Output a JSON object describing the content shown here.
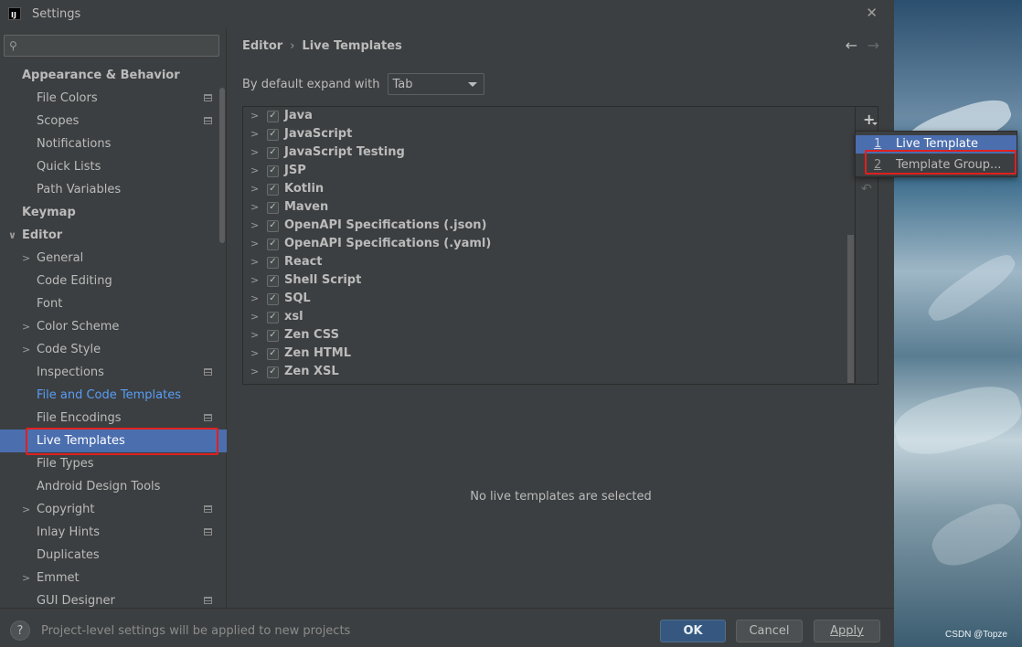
{
  "window": {
    "title": "Settings",
    "logo_text": "IJ"
  },
  "search": {
    "placeholder": "",
    "icon": "search-icon"
  },
  "sidebar": {
    "items": [
      {
        "label": "Appearance & Behavior",
        "level": 0,
        "arrow": "",
        "icon": false
      },
      {
        "label": "File Colors",
        "level": 1,
        "arrow": "",
        "icon": true
      },
      {
        "label": "Scopes",
        "level": 1,
        "arrow": "",
        "icon": true
      },
      {
        "label": "Notifications",
        "level": 1,
        "arrow": "",
        "icon": false
      },
      {
        "label": "Quick Lists",
        "level": 1,
        "arrow": "",
        "icon": false
      },
      {
        "label": "Path Variables",
        "level": 1,
        "arrow": "",
        "icon": false
      },
      {
        "label": "Keymap",
        "level": 0,
        "arrow": "",
        "icon": false
      },
      {
        "label": "Editor",
        "level": 0,
        "arrow": "∨",
        "icon": false
      },
      {
        "label": "General",
        "level": 1,
        "arrow": ">",
        "icon": false
      },
      {
        "label": "Code Editing",
        "level": 1,
        "arrow": "",
        "icon": false
      },
      {
        "label": "Font",
        "level": 1,
        "arrow": "",
        "icon": false
      },
      {
        "label": "Color Scheme",
        "level": 1,
        "arrow": ">",
        "icon": false
      },
      {
        "label": "Code Style",
        "level": 1,
        "arrow": ">",
        "icon": false
      },
      {
        "label": "Inspections",
        "level": 1,
        "arrow": "",
        "icon": true
      },
      {
        "label": "File and Code Templates",
        "level": 1,
        "arrow": "",
        "icon": false,
        "link": true
      },
      {
        "label": "File Encodings",
        "level": 1,
        "arrow": "",
        "icon": true
      },
      {
        "label": "Live Templates",
        "level": 1,
        "arrow": "",
        "icon": false,
        "selected": true
      },
      {
        "label": "File Types",
        "level": 1,
        "arrow": "",
        "icon": false
      },
      {
        "label": "Android Design Tools",
        "level": 1,
        "arrow": "",
        "icon": false
      },
      {
        "label": "Copyright",
        "level": 1,
        "arrow": ">",
        "icon": true
      },
      {
        "label": "Inlay Hints",
        "level": 1,
        "arrow": "",
        "icon": true
      },
      {
        "label": "Duplicates",
        "level": 1,
        "arrow": "",
        "icon": false
      },
      {
        "label": "Emmet",
        "level": 1,
        "arrow": ">",
        "icon": false
      },
      {
        "label": "GUI Designer",
        "level": 1,
        "arrow": "",
        "icon": true
      }
    ]
  },
  "breadcrumb": {
    "parent": "Editor",
    "separator": "›",
    "current": "Live Templates"
  },
  "expand": {
    "label": "By default expand with",
    "value": "Tab"
  },
  "templates": [
    {
      "name": "Java",
      "checked": true
    },
    {
      "name": "JavaScript",
      "checked": true
    },
    {
      "name": "JavaScript Testing",
      "checked": true
    },
    {
      "name": "JSP",
      "checked": true
    },
    {
      "name": "Kotlin",
      "checked": true
    },
    {
      "name": "Maven",
      "checked": true
    },
    {
      "name": "OpenAPI Specifications (.json)",
      "checked": true
    },
    {
      "name": "OpenAPI Specifications (.yaml)",
      "checked": true
    },
    {
      "name": "React",
      "checked": true
    },
    {
      "name": "Shell Script",
      "checked": true
    },
    {
      "name": "SQL",
      "checked": true
    },
    {
      "name": "xsl",
      "checked": true
    },
    {
      "name": "Zen CSS",
      "checked": true
    },
    {
      "name": "Zen HTML",
      "checked": true
    },
    {
      "name": "Zen XSL",
      "checked": true
    }
  ],
  "popup": {
    "items": [
      {
        "num": "1",
        "label": "Live Template",
        "active": true
      },
      {
        "num": "2",
        "label": "Template Group...",
        "active": false
      }
    ]
  },
  "empty_message": "No live templates are selected",
  "footer": {
    "help": "?",
    "note": "Project-level settings will be applied to new projects",
    "ok": "OK",
    "cancel": "Cancel",
    "apply": "Apply"
  },
  "watermark": "CSDN @Topze",
  "colors": {
    "selection": "#4b6eaf",
    "link": "#589df6",
    "highlight": "#e02020",
    "ok_button": "#365880"
  }
}
